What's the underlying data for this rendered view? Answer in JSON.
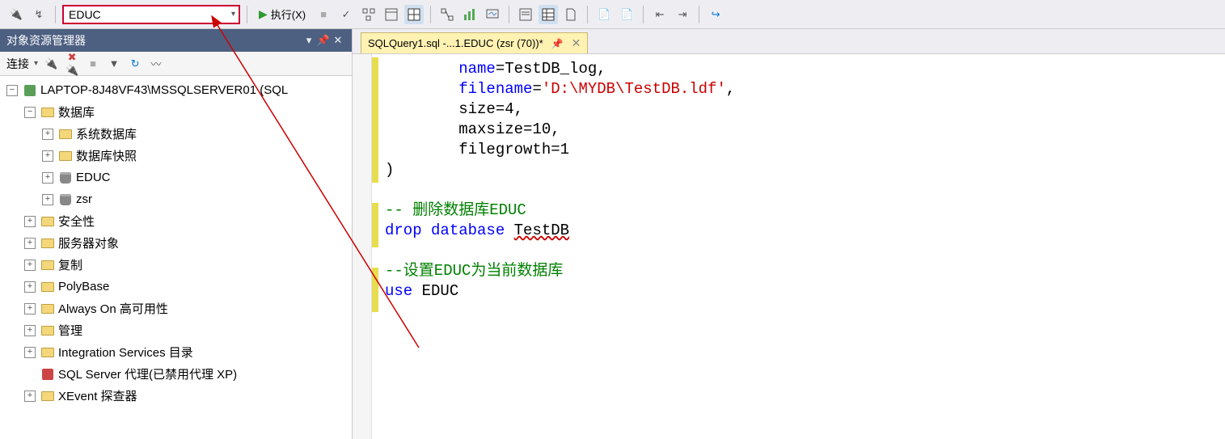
{
  "toolbar": {
    "database_dropdown_value": "EDUC",
    "execute_label": "执行(X)"
  },
  "explorer": {
    "panel_title": "对象资源管理器",
    "connect_label": "连接",
    "server_node": "LAPTOP-8J48VF43\\MSSQLSERVER01 (SQL",
    "nodes": {
      "databases": "数据库",
      "system_db": "系统数据库",
      "db_snapshot": "数据库快照",
      "educ": "EDUC",
      "zsr": "zsr",
      "security": "安全性",
      "server_objects": "服务器对象",
      "replication": "复制",
      "polybase": "PolyBase",
      "alwayson": "Always On 高可用性",
      "management": "管理",
      "isc": "Integration Services 目录",
      "agent": "SQL Server 代理(已禁用代理 XP)",
      "xevent": "XEvent 探查器"
    }
  },
  "editor": {
    "tab_title": "SQLQuery1.sql -...1.EDUC (zsr (70))*",
    "code": {
      "l1_a": "name",
      "l1_b": "=TestDB_log,",
      "l2_a": "filename",
      "l2_b": "=",
      "l2_c": "'D:\\MYDB\\TestDB.ldf'",
      "l2_d": ",",
      "l3": "size=4,",
      "l4": "maxsize=10,",
      "l5": "filegrowth=1",
      "l6": ")",
      "l7": "",
      "l8_cm": "-- 删除数据库EDUC",
      "l9_a": "drop",
      "l9_b": "database",
      "l9_c": "TestDB",
      "l10": "",
      "l11_cm": "--设置EDUC为当前数据库",
      "l12_a": "use",
      "l12_b": " EDUC"
    }
  }
}
